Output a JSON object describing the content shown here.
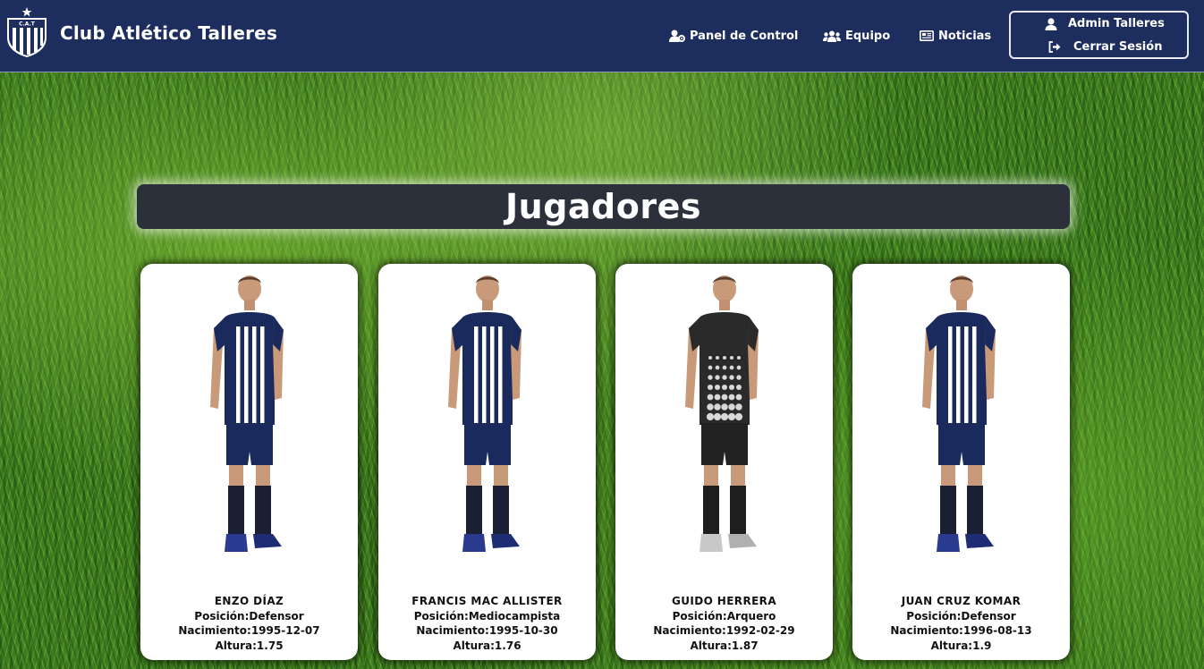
{
  "navbar": {
    "logo_text": "C.A.T",
    "brand": "Club Atlético Talleres",
    "links": [
      {
        "label": "Panel de Control",
        "icon": "user-gear-icon"
      },
      {
        "label": "Equipo",
        "icon": "users-icon"
      },
      {
        "label": "Noticias",
        "icon": "newspaper-icon"
      }
    ],
    "user": {
      "name": "Admin Talleres",
      "logout": "Cerrar Sesión"
    }
  },
  "page": {
    "title": "Jugadores"
  },
  "players": [
    {
      "name": "ENZO DÍAZ",
      "position": "Posición:Defensor",
      "birth": "Nacimiento:1995-12-07",
      "height": "Altura:1.75",
      "kit": "outfield"
    },
    {
      "name": "FRANCIS MAC ALLISTER",
      "position": "Posición:Mediocampista",
      "birth": "Nacimiento:1995-10-30",
      "height": "Altura:1.76",
      "kit": "outfield"
    },
    {
      "name": "GUIDO HERRERA",
      "position": "Posición:Arquero",
      "birth": "Nacimiento:1992-02-29",
      "height": "Altura:1.87",
      "kit": "goalkeeper"
    },
    {
      "name": "JUAN CRUZ KOMAR",
      "position": "Posición:Defensor",
      "birth": "Nacimiento:1996-08-13",
      "height": "Altura:1.9",
      "kit": "outfield"
    }
  ],
  "colors": {
    "navbar": "#1d2d5e",
    "title_band": "#2b303a",
    "kit_blue": "#1b2a5c",
    "kit_white": "#ffffff",
    "gk_kit": "#2a2a2a"
  }
}
